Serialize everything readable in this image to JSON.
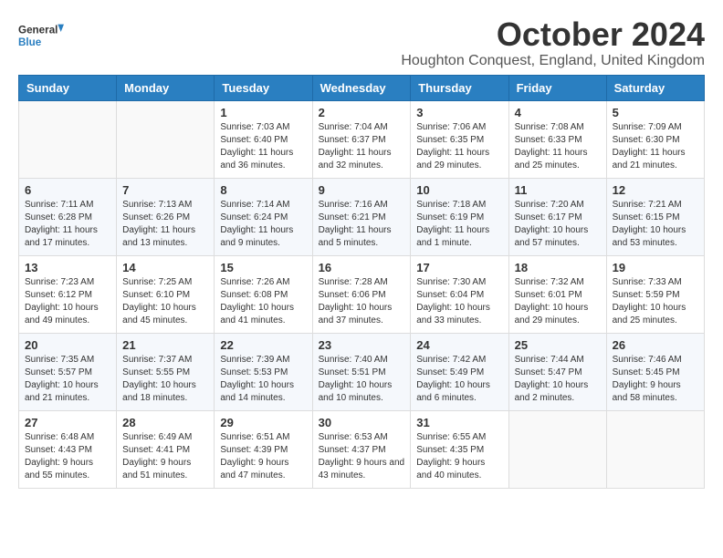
{
  "header": {
    "logo_line1": "General",
    "logo_line2": "Blue",
    "month": "October 2024",
    "location": "Houghton Conquest, England, United Kingdom"
  },
  "weekdays": [
    "Sunday",
    "Monday",
    "Tuesday",
    "Wednesday",
    "Thursday",
    "Friday",
    "Saturday"
  ],
  "weeks": [
    [
      {
        "day": "",
        "info": ""
      },
      {
        "day": "",
        "info": ""
      },
      {
        "day": "1",
        "info": "Sunrise: 7:03 AM\nSunset: 6:40 PM\nDaylight: 11 hours and 36 minutes."
      },
      {
        "day": "2",
        "info": "Sunrise: 7:04 AM\nSunset: 6:37 PM\nDaylight: 11 hours and 32 minutes."
      },
      {
        "day": "3",
        "info": "Sunrise: 7:06 AM\nSunset: 6:35 PM\nDaylight: 11 hours and 29 minutes."
      },
      {
        "day": "4",
        "info": "Sunrise: 7:08 AM\nSunset: 6:33 PM\nDaylight: 11 hours and 25 minutes."
      },
      {
        "day": "5",
        "info": "Sunrise: 7:09 AM\nSunset: 6:30 PM\nDaylight: 11 hours and 21 minutes."
      }
    ],
    [
      {
        "day": "6",
        "info": "Sunrise: 7:11 AM\nSunset: 6:28 PM\nDaylight: 11 hours and 17 minutes."
      },
      {
        "day": "7",
        "info": "Sunrise: 7:13 AM\nSunset: 6:26 PM\nDaylight: 11 hours and 13 minutes."
      },
      {
        "day": "8",
        "info": "Sunrise: 7:14 AM\nSunset: 6:24 PM\nDaylight: 11 hours and 9 minutes."
      },
      {
        "day": "9",
        "info": "Sunrise: 7:16 AM\nSunset: 6:21 PM\nDaylight: 11 hours and 5 minutes."
      },
      {
        "day": "10",
        "info": "Sunrise: 7:18 AM\nSunset: 6:19 PM\nDaylight: 11 hours and 1 minute."
      },
      {
        "day": "11",
        "info": "Sunrise: 7:20 AM\nSunset: 6:17 PM\nDaylight: 10 hours and 57 minutes."
      },
      {
        "day": "12",
        "info": "Sunrise: 7:21 AM\nSunset: 6:15 PM\nDaylight: 10 hours and 53 minutes."
      }
    ],
    [
      {
        "day": "13",
        "info": "Sunrise: 7:23 AM\nSunset: 6:12 PM\nDaylight: 10 hours and 49 minutes."
      },
      {
        "day": "14",
        "info": "Sunrise: 7:25 AM\nSunset: 6:10 PM\nDaylight: 10 hours and 45 minutes."
      },
      {
        "day": "15",
        "info": "Sunrise: 7:26 AM\nSunset: 6:08 PM\nDaylight: 10 hours and 41 minutes."
      },
      {
        "day": "16",
        "info": "Sunrise: 7:28 AM\nSunset: 6:06 PM\nDaylight: 10 hours and 37 minutes."
      },
      {
        "day": "17",
        "info": "Sunrise: 7:30 AM\nSunset: 6:04 PM\nDaylight: 10 hours and 33 minutes."
      },
      {
        "day": "18",
        "info": "Sunrise: 7:32 AM\nSunset: 6:01 PM\nDaylight: 10 hours and 29 minutes."
      },
      {
        "day": "19",
        "info": "Sunrise: 7:33 AM\nSunset: 5:59 PM\nDaylight: 10 hours and 25 minutes."
      }
    ],
    [
      {
        "day": "20",
        "info": "Sunrise: 7:35 AM\nSunset: 5:57 PM\nDaylight: 10 hours and 21 minutes."
      },
      {
        "day": "21",
        "info": "Sunrise: 7:37 AM\nSunset: 5:55 PM\nDaylight: 10 hours and 18 minutes."
      },
      {
        "day": "22",
        "info": "Sunrise: 7:39 AM\nSunset: 5:53 PM\nDaylight: 10 hours and 14 minutes."
      },
      {
        "day": "23",
        "info": "Sunrise: 7:40 AM\nSunset: 5:51 PM\nDaylight: 10 hours and 10 minutes."
      },
      {
        "day": "24",
        "info": "Sunrise: 7:42 AM\nSunset: 5:49 PM\nDaylight: 10 hours and 6 minutes."
      },
      {
        "day": "25",
        "info": "Sunrise: 7:44 AM\nSunset: 5:47 PM\nDaylight: 10 hours and 2 minutes."
      },
      {
        "day": "26",
        "info": "Sunrise: 7:46 AM\nSunset: 5:45 PM\nDaylight: 9 hours and 58 minutes."
      }
    ],
    [
      {
        "day": "27",
        "info": "Sunrise: 6:48 AM\nSunset: 4:43 PM\nDaylight: 9 hours and 55 minutes."
      },
      {
        "day": "28",
        "info": "Sunrise: 6:49 AM\nSunset: 4:41 PM\nDaylight: 9 hours and 51 minutes."
      },
      {
        "day": "29",
        "info": "Sunrise: 6:51 AM\nSunset: 4:39 PM\nDaylight: 9 hours and 47 minutes."
      },
      {
        "day": "30",
        "info": "Sunrise: 6:53 AM\nSunset: 4:37 PM\nDaylight: 9 hours and 43 minutes."
      },
      {
        "day": "31",
        "info": "Sunrise: 6:55 AM\nSunset: 4:35 PM\nDaylight: 9 hours and 40 minutes."
      },
      {
        "day": "",
        "info": ""
      },
      {
        "day": "",
        "info": ""
      }
    ]
  ]
}
